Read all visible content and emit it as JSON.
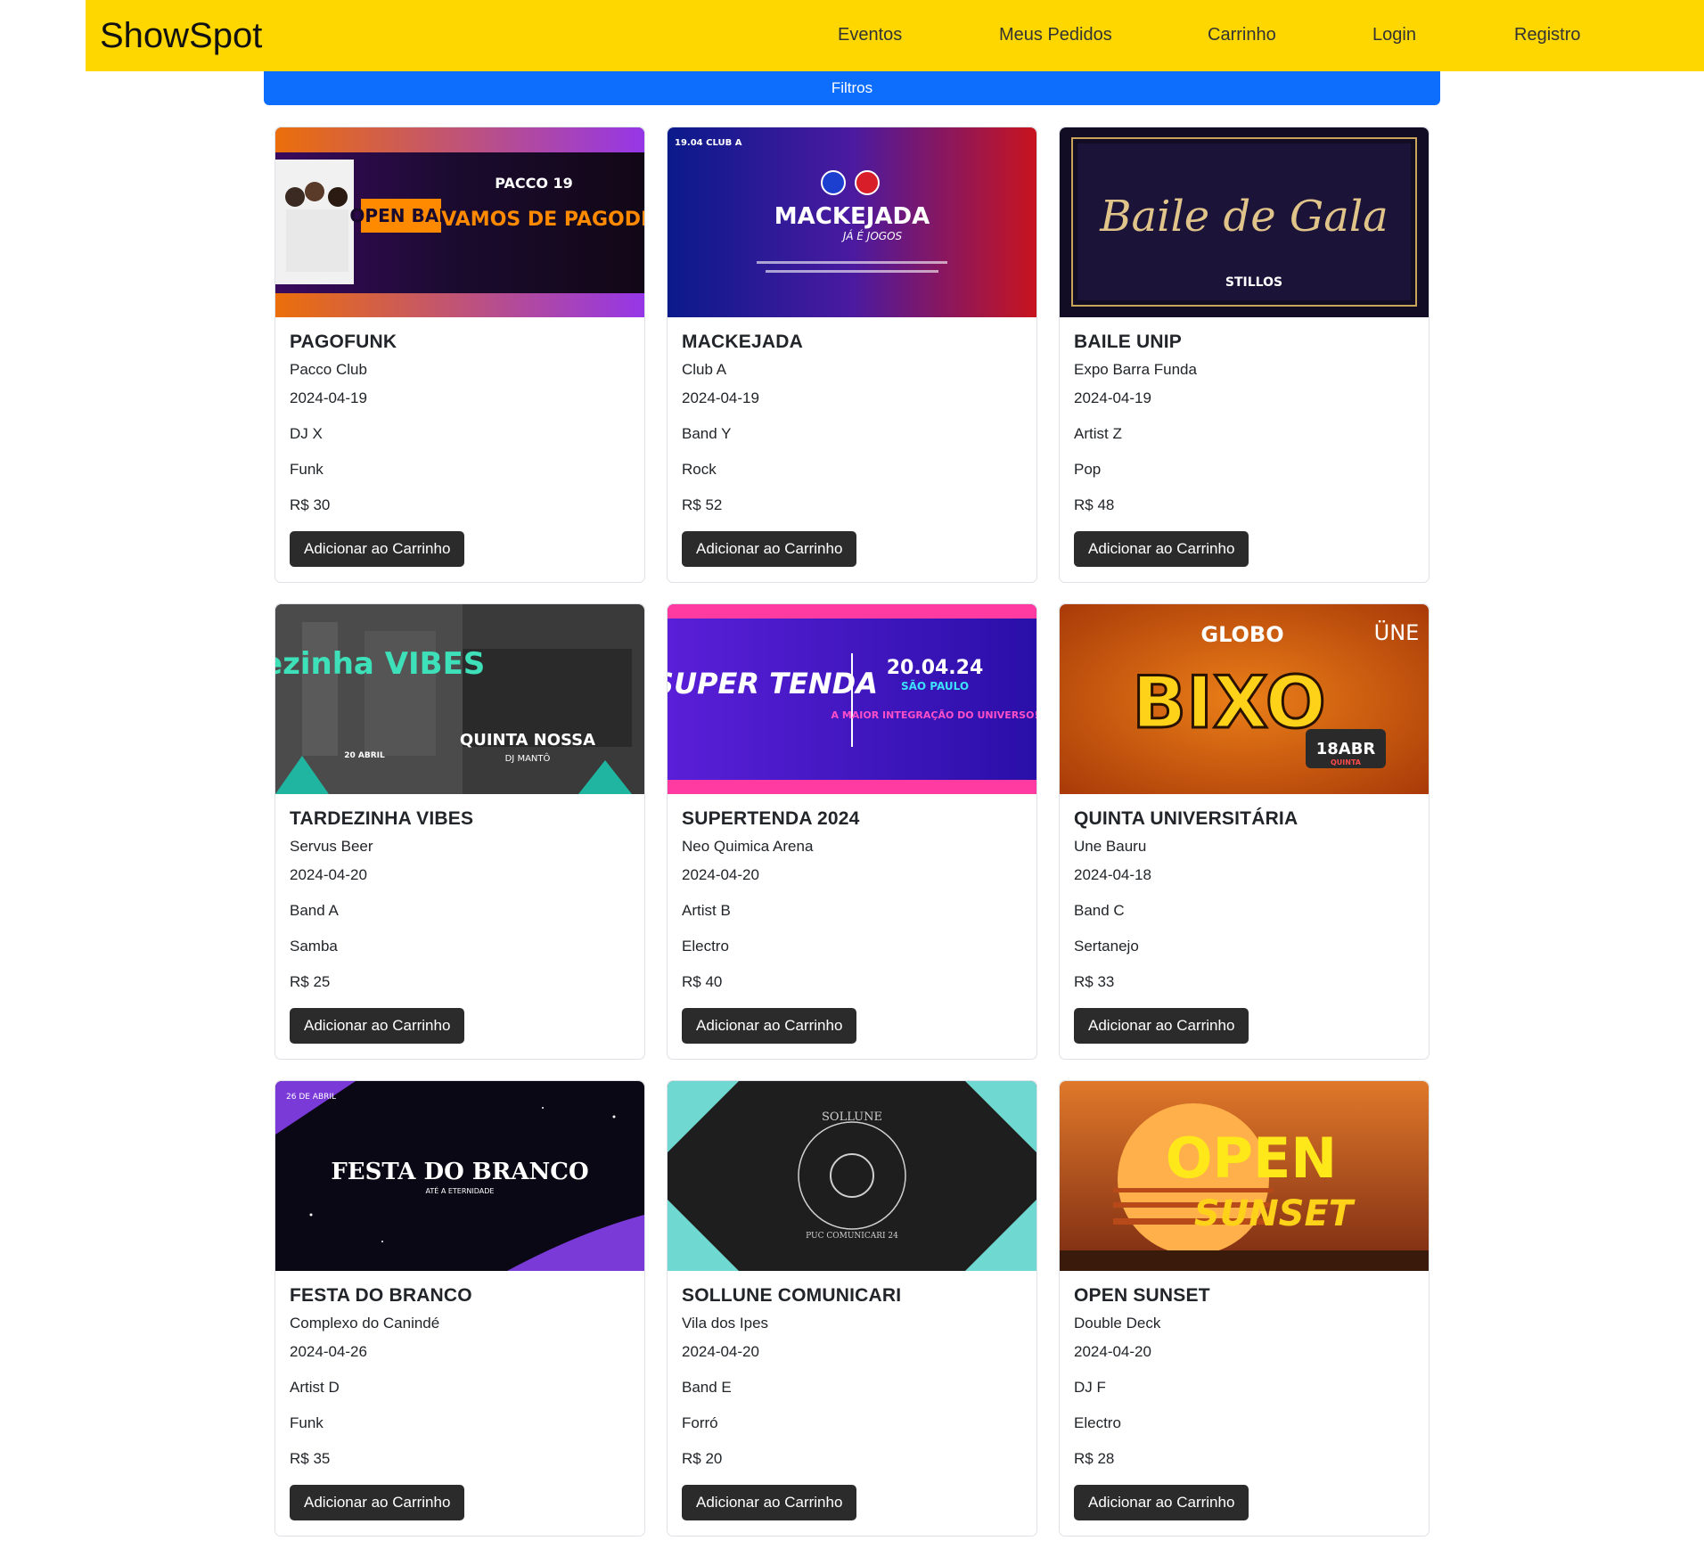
{
  "header": {
    "brand": "ShowSpot",
    "nav": [
      "Eventos",
      "Meus Pedidos",
      "Carrinho",
      "Login",
      "Registro"
    ]
  },
  "filters": {
    "label": "Filtros"
  },
  "colors": {
    "navbar": "#FFD700",
    "filters": "#0d6efd",
    "button": "#2b2b2b"
  },
  "events": [
    {
      "title": "PAGOFUNK",
      "venue": "Pacco Club",
      "date": "2024-04-19",
      "artist": "DJ X",
      "genre": "Funk",
      "price": "R$ 30",
      "button": "Adicionar ao Carrinho",
      "poster": {
        "texts": [
          "OPEN BAR",
          "PACCO 19",
          "VAMOS DE PAGODINHO"
        ]
      }
    },
    {
      "title": "MACKEJADA",
      "venue": "Club A",
      "date": "2024-04-19",
      "artist": "Band Y",
      "genre": "Rock",
      "price": "R$ 52",
      "button": "Adicionar ao Carrinho",
      "poster": {
        "texts": [
          "19.04 CLUB A",
          "MACKEJADA",
          "JÁ É JOGOS"
        ]
      }
    },
    {
      "title": "BAILE UNIP",
      "venue": "Expo Barra Funda",
      "date": "2024-04-19",
      "artist": "Artist Z",
      "genre": "Pop",
      "price": "R$ 48",
      "button": "Adicionar ao Carrinho",
      "poster": {
        "texts": [
          "Baile de Gala",
          "STILLOS"
        ]
      }
    },
    {
      "title": "TARDEZINHA VIBES",
      "venue": "Servus Beer",
      "date": "2024-04-20",
      "artist": "Band A",
      "genre": "Samba",
      "price": "R$ 25",
      "button": "Adicionar ao Carrinho",
      "poster": {
        "texts": [
          "tardezinha VIBES",
          "20 ABRIL",
          "QUINTA NOSSA",
          "DJ MANTÔ"
        ]
      }
    },
    {
      "title": "SUPERTENDA 2024",
      "venue": "Neo Quimica Arena",
      "date": "2024-04-20",
      "artist": "Artist B",
      "genre": "Electro",
      "price": "R$ 40",
      "button": "Adicionar ao Carrinho",
      "poster": {
        "texts": [
          "SUPER TENDA",
          "20.04.24",
          "SÃO PAULO",
          "A MAIOR INTEGRAÇÃO DO UNIVERSO!"
        ]
      }
    },
    {
      "title": "QUINTA UNIVERSITÁRIA",
      "venue": "Une Bauru",
      "date": "2024-04-18",
      "artist": "Band C",
      "genre": "Sertanejo",
      "price": "R$ 33",
      "button": "Adicionar ao Carrinho",
      "poster": {
        "texts": [
          "GLOBO",
          "BIXO",
          "18ABR",
          "QUINTA",
          "ÜNE"
        ]
      }
    },
    {
      "title": "FESTA DO BRANCO",
      "venue": "Complexo do Canindé",
      "date": "2024-04-26",
      "artist": "Artist D",
      "genre": "Funk",
      "price": "R$ 35",
      "button": "Adicionar ao Carrinho",
      "poster": {
        "texts": [
          "26 DE ABRIL",
          "FESTA DO BRANCO",
          "ATÉ A ETERNIDADE"
        ]
      }
    },
    {
      "title": "SOLLUNE COMUNICARI",
      "venue": "Vila dos Ipes",
      "date": "2024-04-20",
      "artist": "Band E",
      "genre": "Forró",
      "price": "R$ 20",
      "button": "Adicionar ao Carrinho",
      "poster": {
        "texts": [
          "SOLLUNE",
          "PUC COMUNICARI 24"
        ]
      }
    },
    {
      "title": "OPEN SUNSET",
      "venue": "Double Deck",
      "date": "2024-04-20",
      "artist": "DJ F",
      "genre": "Electro",
      "price": "R$ 28",
      "button": "Adicionar ao Carrinho",
      "poster": {
        "texts": [
          "OPEN",
          "SUNSET"
        ]
      }
    }
  ]
}
